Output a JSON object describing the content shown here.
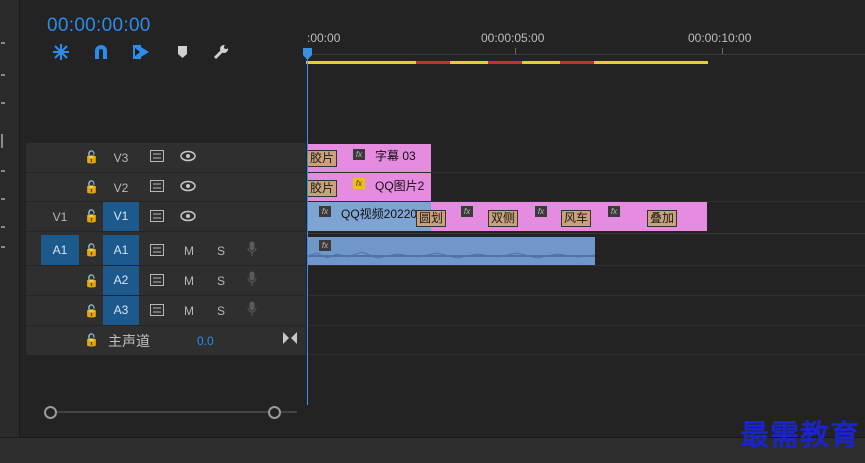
{
  "timecode": "00:00:00:00",
  "ruler": {
    "labels": [
      ":00:00",
      "00:00:05:00",
      "00:00:10:00"
    ]
  },
  "colors": {
    "accent": "#2d8ceb",
    "video_clip": "#e58be0",
    "audio_clip": "#6f97c9",
    "workbar_yellow": "#e5d21c",
    "workbar_red": "#d22a2a"
  },
  "tools": [
    "snap-icon",
    "linked-selection-icon",
    "add-marker-icon",
    "marker-icon",
    "wrench-icon"
  ],
  "tracks": {
    "V3": {
      "name": "V3"
    },
    "V2": {
      "name": "V2"
    },
    "V1": {
      "source": "V1",
      "name": "V1"
    },
    "A1": {
      "source": "A1",
      "name": "A1",
      "m": "M",
      "s": "S"
    },
    "A2": {
      "name": "A2",
      "m": "M",
      "s": "S"
    },
    "A3": {
      "name": "A3",
      "m": "M",
      "s": "S"
    },
    "master": {
      "label": "主声道",
      "value": "0.0"
    }
  },
  "clips": {
    "v3": {
      "tag": "胶片",
      "fx": "fx",
      "name": "字幕 03"
    },
    "v2": {
      "tag": "胶片",
      "fx": "fx",
      "name": "QQ图片2"
    },
    "v1": {
      "fx": "fx",
      "name": "QQ视频20220",
      "transitions": [
        "圆划",
        "双侧",
        "风车",
        "叠加"
      ]
    },
    "a1": {
      "fx": "fx"
    }
  },
  "watermark": "最需教育"
}
